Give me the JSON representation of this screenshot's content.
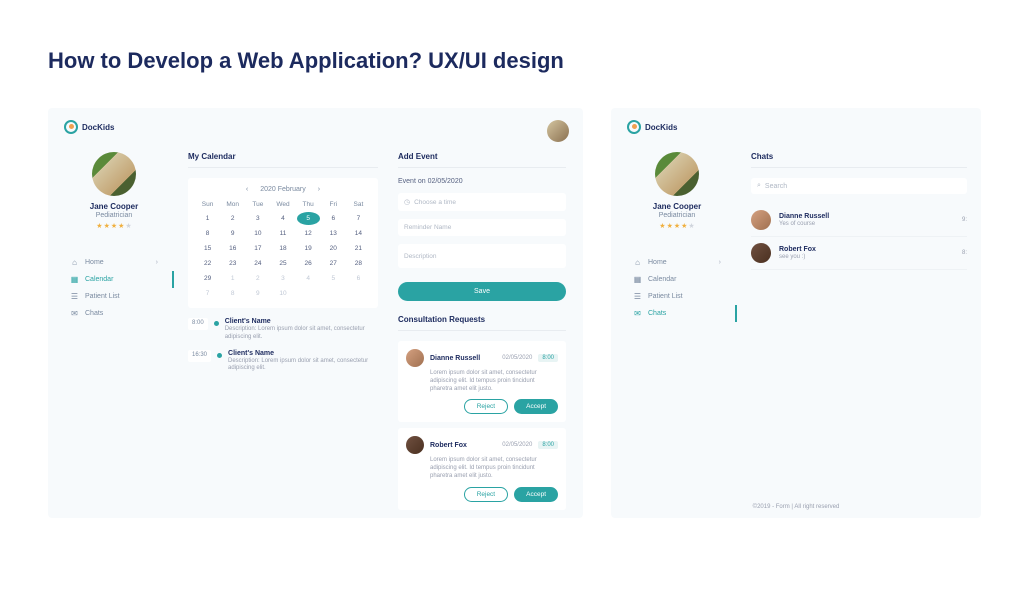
{
  "page_title": "How to Develop a Web Application? UX/UI design",
  "brand": "DocKids",
  "user": {
    "name": "Jane Cooper",
    "role": "Pediatrician",
    "rating": 4
  },
  "nav": {
    "home": "Home",
    "calendar": "Calendar",
    "patients": "Patient List",
    "chats": "Chats"
  },
  "calendar": {
    "title": "My Calendar",
    "period": "2020  February",
    "dows": [
      "Sun",
      "Mon",
      "Tue",
      "Wed",
      "Thu",
      "Fri",
      "Sat"
    ],
    "days": [
      1,
      2,
      3,
      4,
      5,
      6,
      7,
      8,
      9,
      10,
      11,
      12,
      13,
      14,
      15,
      16,
      17,
      18,
      19,
      20,
      21,
      22,
      23,
      24,
      25,
      26,
      27,
      28,
      29
    ],
    "next": [
      1,
      2,
      3,
      4,
      5,
      6,
      7,
      8,
      9,
      10
    ],
    "selected": 5
  },
  "appointments": [
    {
      "time": "8:00",
      "name": "Client's Name",
      "desc": "Description: Lorem ipsum dolor sit amet, consectetur adipiscing elit."
    },
    {
      "time": "16:30",
      "name": "Client's Name",
      "desc": "Description: Lorem ipsum dolor sit amet, consectetur adipiscing elit."
    }
  ],
  "add_event": {
    "title": "Add Event",
    "date_label": "Event on 02/05/2020",
    "time_ph": "Choose a time",
    "name_ph": "Reminder Name",
    "desc_ph": "Description",
    "save": "Save"
  },
  "requests": {
    "title": "Consultation Requests",
    "reject": "Reject",
    "accept": "Accept",
    "items": [
      {
        "name": "Dianne Russell",
        "date": "02/05/2020",
        "time": "8:00",
        "desc": "Lorem ipsum dolor sit amet, consectetur adipiscing elit. Id tempus proin tincidunt pharetra amet elit justo."
      },
      {
        "name": "Robert Fox",
        "date": "02/05/2020",
        "time": "8:00",
        "desc": "Lorem ipsum dolor sit amet, consectetur adipiscing elit. Id tempus proin tincidunt pharetra amet elit justo."
      }
    ]
  },
  "chats": {
    "title": "Chats",
    "search_ph": "Search",
    "items": [
      {
        "name": "Dianne Russell",
        "msg": "Yes of course",
        "time": "9:"
      },
      {
        "name": "Robert Fox",
        "msg": "see you :)",
        "time": "8:"
      }
    ]
  },
  "footer": "©2019 - Form  |  All right reserved"
}
